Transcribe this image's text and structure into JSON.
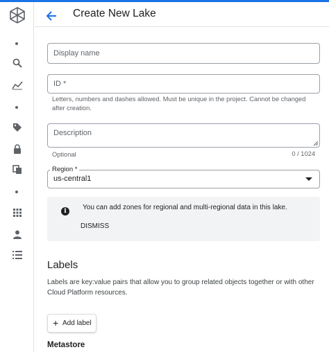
{
  "header": {
    "title": "Create New Lake"
  },
  "form": {
    "display_name": {
      "placeholder": "Display name"
    },
    "id": {
      "label": "ID *",
      "hint": "Letters, numbers and dashes allowed. Must be unique in the project. Cannot be changed after creation."
    },
    "description": {
      "placeholder": "Description",
      "hint": "Optional",
      "counter": "0 / 1024"
    },
    "region": {
      "label": "Region *",
      "value": "us-central1"
    }
  },
  "banner": {
    "message": "You can add zones for regional and multi-regional data in this lake.",
    "dismiss_label": "DISMISS"
  },
  "labels": {
    "heading": "Labels",
    "description": "Labels are key:value pairs that allow you to group related objects together or with other Cloud Platform resources.",
    "add_button": "Add label"
  },
  "metastore": {
    "heading": "Metastore"
  },
  "rail": {
    "icons": [
      "dataplex-logo",
      "search-icon",
      "analytics-icon",
      "tag-icon",
      "lock-icon",
      "copy-icon",
      "apps-icon",
      "person-icon",
      "list-icon"
    ]
  },
  "colors": {
    "accent": "#1a73e8",
    "banner_bg": "#f1f3f4",
    "border": "#9aa0a6"
  }
}
